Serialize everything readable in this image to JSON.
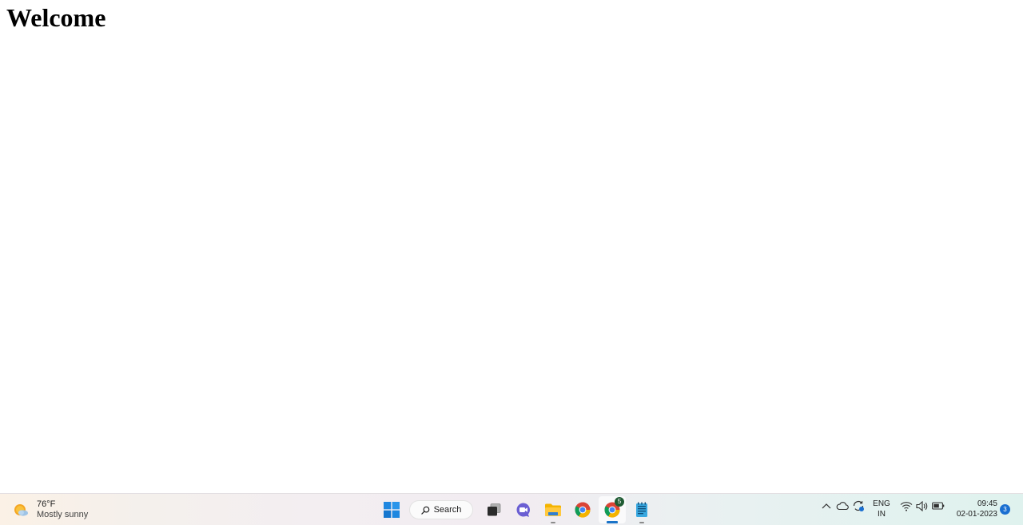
{
  "page": {
    "heading": "Welcome"
  },
  "taskbar": {
    "weather": {
      "temperature": "76°F",
      "condition": "Mostly sunny",
      "icon": "partly-sunny-icon"
    },
    "search": {
      "label": "Search",
      "icon": "search-icon"
    },
    "apps": [
      {
        "name": "start",
        "icon": "windows-logo-icon"
      },
      {
        "name": "task-view",
        "icon": "task-view-icon"
      },
      {
        "name": "teams-chat",
        "icon": "chat-icon"
      },
      {
        "name": "file-explorer",
        "icon": "folder-icon",
        "running": true
      },
      {
        "name": "chrome",
        "icon": "chrome-icon"
      },
      {
        "name": "chrome-active",
        "icon": "chrome-icon",
        "badge": "5",
        "active": true
      },
      {
        "name": "notepad",
        "icon": "notepad-icon",
        "running": true
      }
    ],
    "tray": {
      "language": {
        "line1": "ENG",
        "line2": "IN"
      },
      "time": "09:45",
      "date": "02-01-2023",
      "notification_count": "3"
    }
  },
  "colors": {
    "accent": "#1a73c8",
    "badge_green": "#1f5b33",
    "notification": "#1a6fd1"
  }
}
